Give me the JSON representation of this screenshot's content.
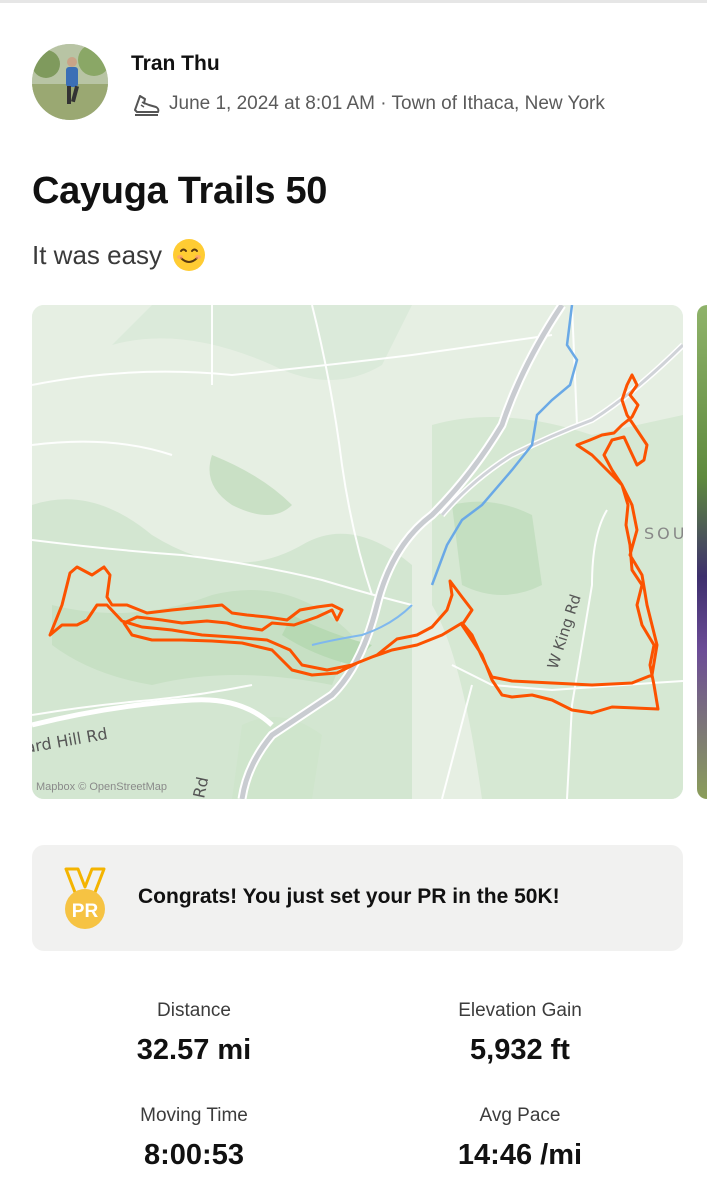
{
  "activity": {
    "athlete_name": "Tran Thu",
    "meta_text": "June 1, 2024 at 8:01 AM · Town of Ithaca, New York",
    "sport_icon": "running-shoe-icon",
    "title": "Cayuga Trails 50",
    "description": "It was easy",
    "description_emoji": "smiling-face-icon"
  },
  "map": {
    "labels": {
      "road1": "ard Hill Rd",
      "road2": "W King Rd",
      "road3": "Rd",
      "place": "SOU"
    },
    "attribution": "Mapbox © OpenStreetMap",
    "route_color": "#fc5200"
  },
  "achievement": {
    "icon": "pr-medal-icon",
    "badge_text": "PR",
    "message": "Congrats! You just set your PR in the 50K!"
  },
  "stats": [
    {
      "label": "Distance",
      "value": "32.57 mi"
    },
    {
      "label": "Elevation Gain",
      "value": "5,932 ft"
    },
    {
      "label": "Moving Time",
      "value": "8:00:53"
    },
    {
      "label": "Avg Pace",
      "value": "14:46 /mi"
    }
  ]
}
